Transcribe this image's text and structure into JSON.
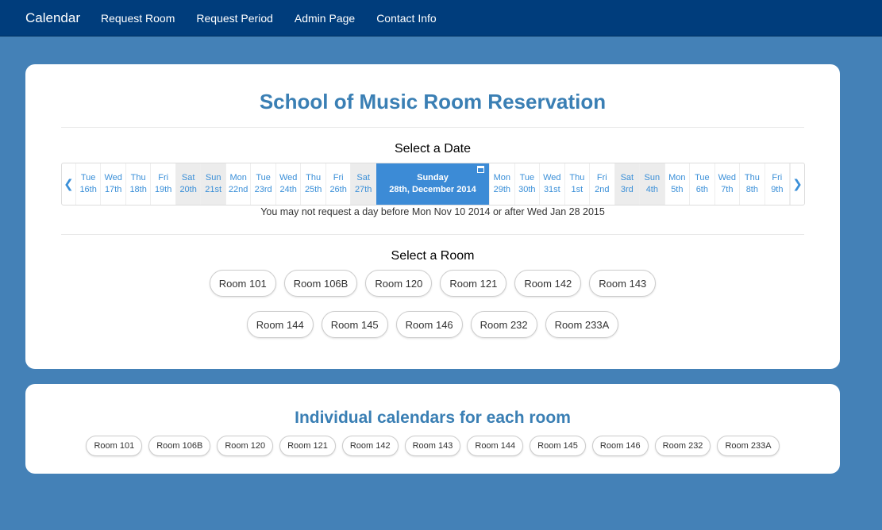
{
  "nav": {
    "brand": "Calendar",
    "links": [
      "Request Room",
      "Request Period",
      "Admin Page",
      "Contact Info"
    ]
  },
  "main": {
    "title": "School of Music Room Reservation",
    "select_date_label": "Select a Date",
    "days_before": [
      {
        "dow": "Tue",
        "date": "16th",
        "weekend": false
      },
      {
        "dow": "Wed",
        "date": "17th",
        "weekend": false
      },
      {
        "dow": "Thu",
        "date": "18th",
        "weekend": false
      },
      {
        "dow": "Fri",
        "date": "19th",
        "weekend": false
      },
      {
        "dow": "Sat",
        "date": "20th",
        "weekend": true
      },
      {
        "dow": "Sun",
        "date": "21st",
        "weekend": true
      },
      {
        "dow": "Mon",
        "date": "22nd",
        "weekend": false
      },
      {
        "dow": "Tue",
        "date": "23rd",
        "weekend": false
      },
      {
        "dow": "Wed",
        "date": "24th",
        "weekend": false
      },
      {
        "dow": "Thu",
        "date": "25th",
        "weekend": false
      },
      {
        "dow": "Fri",
        "date": "26th",
        "weekend": false
      },
      {
        "dow": "Sat",
        "date": "27th",
        "weekend": true
      }
    ],
    "selected_day": {
      "dow": "Sunday",
      "date": "28th, December 2014"
    },
    "days_after": [
      {
        "dow": "Mon",
        "date": "29th",
        "weekend": false
      },
      {
        "dow": "Tue",
        "date": "30th",
        "weekend": false
      },
      {
        "dow": "Wed",
        "date": "31st",
        "weekend": false
      },
      {
        "dow": "Thu",
        "date": "1st",
        "weekend": false
      },
      {
        "dow": "Fri",
        "date": "2nd",
        "weekend": false
      },
      {
        "dow": "Sat",
        "date": "3rd",
        "weekend": true
      },
      {
        "dow": "Sun",
        "date": "4th",
        "weekend": true
      },
      {
        "dow": "Mon",
        "date": "5th",
        "weekend": false
      },
      {
        "dow": "Tue",
        "date": "6th",
        "weekend": false
      },
      {
        "dow": "Wed",
        "date": "7th",
        "weekend": false
      },
      {
        "dow": "Thu",
        "date": "8th",
        "weekend": false
      },
      {
        "dow": "Fri",
        "date": "9th",
        "weekend": false
      }
    ],
    "date_note": "You may not request a day before Mon Nov 10 2014 or after Wed Jan 28 2015",
    "select_room_label": "Select a Room",
    "rooms_row1": [
      "Room 101",
      "Room 106B",
      "Room 120",
      "Room 121",
      "Room 142",
      "Room 143"
    ],
    "rooms_row2": [
      "Room 144",
      "Room 145",
      "Room 146",
      "Room 232",
      "Room 233A"
    ]
  },
  "calendars": {
    "title": "Individual calendars for each room",
    "rooms": [
      "Room 101",
      "Room 106B",
      "Room 120",
      "Room 121",
      "Room 142",
      "Room 143",
      "Room 144",
      "Room 145",
      "Room 146",
      "Room 232",
      "Room 233A"
    ]
  },
  "icons": {
    "prev": "chevron-left-icon",
    "next": "chevron-right-icon",
    "calendar": "calendar-icon"
  },
  "colors": {
    "nav_bg": "#003d7c",
    "page_bg": "#4481b7",
    "accent": "#3c8bd6",
    "title": "#3a7fb4"
  }
}
